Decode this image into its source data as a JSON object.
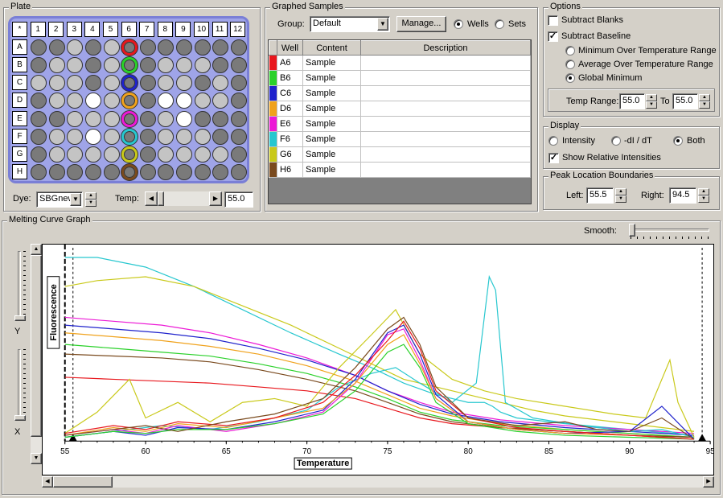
{
  "plate": {
    "title": "Plate",
    "corner": "*",
    "columns": [
      "1",
      "2",
      "3",
      "4",
      "5",
      "6",
      "7",
      "8",
      "9",
      "10",
      "11",
      "12"
    ],
    "rows": [
      "A",
      "B",
      "C",
      "D",
      "E",
      "F",
      "G",
      "H"
    ],
    "shades": [
      "DDLDLDDDDDDD",
      "DLLDLDDLLLDD",
      "LLLDLDDLLDLD",
      "DLLWLDDWWLLD",
      "DDLLLDDLWDDD",
      "DLLWLDDLLLDD",
      "DLLLLDDLLLLD",
      "DDDDDDDDDDDD"
    ],
    "highlight_col": 5,
    "highlight_colors": [
      "#e8171d",
      "#2ad12a",
      "#1f22cc",
      "#f0a21c",
      "#ec1ad6",
      "#27c7cf",
      "#c9c91a",
      "#7a4a1e"
    ],
    "dye_label": "Dye:",
    "dye_value": "SBGnew",
    "temp_label": "Temp:",
    "temp_value": "55.0"
  },
  "graphed": {
    "title": "Graphed Samples",
    "group_label": "Group:",
    "group_value": "Default",
    "manage_label": "Manage...",
    "wells_label": "Wells",
    "sets_label": "Sets",
    "columns": [
      "Well",
      "Content",
      "Description"
    ],
    "rows": [
      {
        "color": "#e8171d",
        "well": "A6",
        "content": "Sample",
        "description": ""
      },
      {
        "color": "#2ad12a",
        "well": "B6",
        "content": "Sample",
        "description": ""
      },
      {
        "color": "#1f22cc",
        "well": "C6",
        "content": "Sample",
        "description": ""
      },
      {
        "color": "#f0a21c",
        "well": "D6",
        "content": "Sample",
        "description": ""
      },
      {
        "color": "#ec1ad6",
        "well": "E6",
        "content": "Sample",
        "description": ""
      },
      {
        "color": "#27c7cf",
        "well": "F6",
        "content": "Sample",
        "description": ""
      },
      {
        "color": "#c9c91a",
        "well": "G6",
        "content": "Sample",
        "description": ""
      },
      {
        "color": "#7a4a1e",
        "well": "H6",
        "content": "Sample",
        "description": ""
      }
    ]
  },
  "options": {
    "title": "Options",
    "subtract_blanks": "Subtract Blanks",
    "subtract_baseline": "Subtract Baseline",
    "min_range": "Minimum Over Temperature Range",
    "avg_range": "Average Over Temperature Range",
    "global_min": "Global Minimum",
    "temp_range_label": "Temp Range:",
    "temp_from": "55.0",
    "to_label": "To",
    "temp_to": "55.0"
  },
  "display": {
    "title": "Display",
    "intensity": "Intensity",
    "deriv": "-dI / dT",
    "both": "Both",
    "relative": "Show Relative Intensities"
  },
  "peak": {
    "title": "Peak Location Boundaries",
    "left_label": "Left:",
    "left_value": "55.5",
    "right_label": "Right:",
    "right_value": "94.5"
  },
  "graph": {
    "title": "Melting Curve Graph",
    "smooth_label": "Smooth:",
    "y_label": "Y",
    "x_label": "X"
  },
  "chart_data": {
    "type": "line",
    "xlabel": "Temperature",
    "ylabel": "Fluorescence",
    "xlim": [
      55,
      95
    ],
    "ylim": [
      0,
      1
    ],
    "xticks": [
      55,
      60,
      65,
      70,
      75,
      80,
      85,
      90,
      95
    ],
    "xtick_labels": [
      "55",
      "60",
      "65",
      "70",
      "75",
      "80",
      "85",
      "90",
      "95"
    ],
    "peak_bounds": [
      55.5,
      94.5
    ],
    "series": [
      {
        "color": "#27c7cf",
        "kind": "intensity",
        "x": [
          55,
          57,
          60,
          63,
          66,
          69,
          72,
          74,
          76,
          78,
          80,
          81,
          81.5,
          82,
          83,
          86,
          90,
          94
        ],
        "y": [
          0.95,
          0.95,
          0.9,
          0.8,
          0.68,
          0.56,
          0.45,
          0.38,
          0.3,
          0.24,
          0.2,
          0.2,
          0.18,
          0.15,
          0.12,
          0.09,
          0.06,
          0.03
        ]
      },
      {
        "color": "#c9c91a",
        "kind": "intensity",
        "x": [
          55,
          57,
          60,
          63,
          66,
          69,
          72,
          74,
          76,
          78,
          80,
          82,
          84,
          86,
          90,
          94
        ],
        "y": [
          0.8,
          0.83,
          0.85,
          0.8,
          0.7,
          0.6,
          0.48,
          0.4,
          0.32,
          0.28,
          0.24,
          0.2,
          0.16,
          0.13,
          0.09,
          0.05
        ]
      },
      {
        "color": "#ec1ad6",
        "kind": "intensity",
        "x": [
          55,
          58,
          61,
          64,
          67,
          70,
          73,
          75,
          77,
          79,
          82,
          86,
          90,
          94
        ],
        "y": [
          0.64,
          0.62,
          0.6,
          0.56,
          0.5,
          0.43,
          0.34,
          0.26,
          0.2,
          0.15,
          0.11,
          0.08,
          0.06,
          0.04
        ]
      },
      {
        "color": "#1f22cc",
        "kind": "intensity",
        "x": [
          55,
          58,
          61,
          64,
          67,
          70,
          73,
          75,
          77,
          79,
          82,
          86,
          90,
          94
        ],
        "y": [
          0.6,
          0.58,
          0.56,
          0.53,
          0.48,
          0.42,
          0.34,
          0.26,
          0.19,
          0.14,
          0.1,
          0.07,
          0.05,
          0.03
        ]
      },
      {
        "color": "#f0a21c",
        "kind": "intensity",
        "x": [
          55,
          58,
          61,
          64,
          67,
          70,
          73,
          75,
          77,
          79,
          82,
          86,
          90,
          94
        ],
        "y": [
          0.56,
          0.54,
          0.52,
          0.49,
          0.45,
          0.39,
          0.31,
          0.24,
          0.17,
          0.13,
          0.09,
          0.06,
          0.04,
          0.02
        ]
      },
      {
        "color": "#2ad12a",
        "kind": "intensity",
        "x": [
          55,
          58,
          61,
          64,
          67,
          70,
          73,
          75,
          77,
          79,
          82,
          86,
          90,
          94
        ],
        "y": [
          0.5,
          0.48,
          0.46,
          0.44,
          0.4,
          0.35,
          0.28,
          0.22,
          0.15,
          0.11,
          0.08,
          0.06,
          0.04,
          0.02
        ]
      },
      {
        "color": "#e8171d",
        "kind": "intensity",
        "x": [
          55,
          58,
          61,
          64,
          67,
          70,
          73,
          75,
          77,
          79,
          82,
          86,
          90,
          94
        ],
        "y": [
          0.33,
          0.32,
          0.31,
          0.3,
          0.28,
          0.26,
          0.22,
          0.17,
          0.12,
          0.09,
          0.07,
          0.05,
          0.03,
          0.02
        ]
      },
      {
        "color": "#7a4a1e",
        "kind": "intensity",
        "x": [
          55,
          58,
          61,
          64,
          67,
          70,
          73,
          75,
          77,
          79,
          82,
          86,
          90,
          94
        ],
        "y": [
          0.45,
          0.44,
          0.43,
          0.41,
          0.37,
          0.32,
          0.26,
          0.2,
          0.14,
          0.1,
          0.07,
          0.05,
          0.03,
          0.02
        ]
      },
      {
        "color": "#27c7cf",
        "kind": "derivative",
        "x": [
          55,
          58,
          61,
          64,
          67,
          70,
          72,
          74,
          75.5,
          77,
          79,
          80.5,
          81.3,
          81.7,
          82.3,
          84,
          87,
          90,
          92,
          94
        ],
        "y": [
          0.02,
          0.05,
          0.08,
          0.06,
          0.1,
          0.16,
          0.28,
          0.35,
          0.38,
          0.3,
          0.2,
          0.3,
          0.85,
          0.78,
          0.2,
          0.12,
          0.08,
          0.05,
          0.06,
          0.02
        ]
      },
      {
        "color": "#c9c91a",
        "kind": "derivative",
        "x": [
          55,
          57,
          59,
          60,
          62,
          64,
          66,
          68,
          70,
          72,
          74,
          75.5,
          77,
          79,
          81,
          83,
          86,
          89,
          91,
          92.5,
          93,
          94
        ],
        "y": [
          0.04,
          0.15,
          0.32,
          0.12,
          0.2,
          0.1,
          0.2,
          0.22,
          0.18,
          0.38,
          0.55,
          0.68,
          0.45,
          0.32,
          0.26,
          0.22,
          0.18,
          0.14,
          0.12,
          0.42,
          0.2,
          0.02
        ]
      },
      {
        "color": "#ec1ad6",
        "kind": "derivative",
        "x": [
          55,
          58,
          60,
          62,
          65,
          68,
          71,
          73,
          75,
          76,
          77,
          78,
          80,
          83,
          86,
          90,
          94
        ],
        "y": [
          0.03,
          0.06,
          0.04,
          0.08,
          0.05,
          0.09,
          0.15,
          0.3,
          0.55,
          0.58,
          0.42,
          0.22,
          0.1,
          0.06,
          0.04,
          0.03,
          0.01
        ]
      },
      {
        "color": "#1f22cc",
        "kind": "derivative",
        "x": [
          55,
          58,
          60,
          62,
          65,
          68,
          71,
          73,
          75,
          76,
          77,
          78,
          80,
          83,
          86,
          90,
          92,
          94
        ],
        "y": [
          0.02,
          0.05,
          0.03,
          0.07,
          0.06,
          0.1,
          0.16,
          0.32,
          0.56,
          0.6,
          0.45,
          0.24,
          0.1,
          0.06,
          0.04,
          0.05,
          0.18,
          0.01
        ]
      },
      {
        "color": "#f0a21c",
        "kind": "derivative",
        "x": [
          55,
          58,
          60,
          62,
          65,
          68,
          71,
          73,
          75,
          76,
          77,
          78,
          80,
          83,
          86,
          90,
          94
        ],
        "y": [
          0.03,
          0.07,
          0.05,
          0.09,
          0.07,
          0.12,
          0.17,
          0.3,
          0.5,
          0.55,
          0.4,
          0.22,
          0.1,
          0.06,
          0.04,
          0.03,
          0.01
        ]
      },
      {
        "color": "#2ad12a",
        "kind": "derivative",
        "x": [
          55,
          58,
          60,
          62,
          65,
          68,
          71,
          73,
          75,
          76,
          77,
          78,
          80,
          83,
          86,
          90,
          94
        ],
        "y": [
          0.02,
          0.05,
          0.04,
          0.06,
          0.06,
          0.09,
          0.14,
          0.26,
          0.46,
          0.5,
          0.38,
          0.2,
          0.09,
          0.05,
          0.03,
          0.02,
          0.01
        ]
      },
      {
        "color": "#e8171d",
        "kind": "derivative",
        "x": [
          55,
          58,
          60,
          62,
          65,
          68,
          71,
          73,
          75,
          76,
          77,
          78,
          80,
          83,
          86,
          90,
          94
        ],
        "y": [
          0.04,
          0.08,
          0.06,
          0.1,
          0.08,
          0.12,
          0.2,
          0.34,
          0.52,
          0.62,
          0.48,
          0.26,
          0.12,
          0.07,
          0.05,
          0.03,
          0.01
        ]
      },
      {
        "color": "#7a4a1e",
        "kind": "derivative",
        "x": [
          55,
          58,
          60,
          62,
          65,
          68,
          71,
          73,
          75,
          76,
          77,
          78,
          80,
          83,
          86,
          88,
          90,
          92,
          94
        ],
        "y": [
          0.03,
          0.06,
          0.08,
          0.05,
          0.1,
          0.14,
          0.22,
          0.38,
          0.58,
          0.64,
          0.5,
          0.28,
          0.12,
          0.08,
          0.1,
          0.06,
          0.05,
          0.12,
          0.01
        ]
      }
    ]
  }
}
